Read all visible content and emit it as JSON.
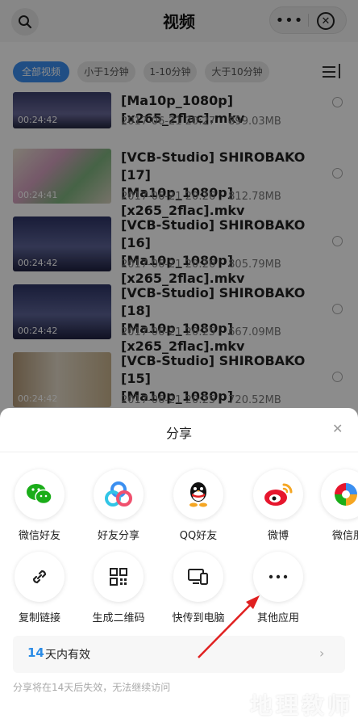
{
  "header": {
    "title": "视频",
    "more_label": "•••",
    "close_label": "✕"
  },
  "filters": [
    {
      "label": "全部视频",
      "active": true
    },
    {
      "label": "小于1分钟",
      "active": false
    },
    {
      "label": "1-10分钟",
      "active": false
    },
    {
      "label": "大于10分钟",
      "active": false
    }
  ],
  "videos": [
    {
      "line1": "",
      "line2": "[Ma10p_1080p][x265_2flac].mkv",
      "date": "2017-06-21 20:27",
      "size": "899.03MB",
      "duration": "00:24:42"
    },
    {
      "line1": "[VCB-Studio] SHIROBAKO [17]",
      "line2": "[Ma10p_1080p][x265_2flac].mkv",
      "date": "2017-06-21 20:26",
      "size": "812.78MB",
      "duration": "00:24:41"
    },
    {
      "line1": "[VCB-Studio] SHIROBAKO [16]",
      "line2": "[Ma10p_1080p][x265_2flac].mkv",
      "date": "2017-06-21 20:26",
      "size": "805.79MB",
      "duration": "00:24:42"
    },
    {
      "line1": "[VCB-Studio] SHIROBAKO [18]",
      "line2": "[Ma10p_1080p][x265_2flac].mkv",
      "date": "2017-06-21 20:25",
      "size": "667.09MB",
      "duration": "00:24:42"
    },
    {
      "line1": "[VCB-Studio] SHIROBAKO [15]",
      "line2": "[Ma10p_1080p][x265_2flac].mkv",
      "date": "2017-06-21 20:25",
      "size": "720.52MB",
      "duration": "00:24:42"
    }
  ],
  "share": {
    "title": "分享",
    "close_label": "✕",
    "row1": [
      {
        "label": "微信好友",
        "icon": "wechat-icon"
      },
      {
        "label": "好友分享",
        "icon": "friend-share-icon"
      },
      {
        "label": "QQ好友",
        "icon": "qq-icon"
      },
      {
        "label": "微博",
        "icon": "weibo-icon"
      },
      {
        "label": "微信朋",
        "icon": "wechat-moments-icon"
      }
    ],
    "row2": [
      {
        "label": "复制链接",
        "icon": "link-icon"
      },
      {
        "label": "生成二维码",
        "icon": "qrcode-icon"
      },
      {
        "label": "快传到电脑",
        "icon": "send-to-pc-icon"
      },
      {
        "label": "其他应用",
        "icon": "more-apps-icon"
      }
    ],
    "validity_days": "14",
    "validity_text": "天内有效",
    "validity_chevron": "›",
    "note": "分享将在14天后失效，无法继续访问"
  },
  "watermark": "地理教师",
  "colors": {
    "accent": "#3b8ff0",
    "validity_number": "#2b8ce6",
    "annotation_arrow": "#e02020"
  }
}
